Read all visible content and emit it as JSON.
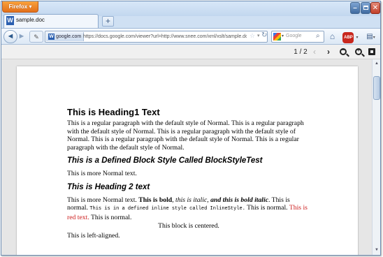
{
  "browser": {
    "menu_label": "Firefox",
    "menu_caret": "▾",
    "tab": {
      "icon_letter": "W",
      "title": "sample.doc"
    },
    "new_tab_symbol": "+",
    "nav": {
      "back_symbol": "◄",
      "forward_symbol": "►",
      "site_identity": "google.com",
      "url": "https://docs.google.com/viewer?url=http://www.snee.com/xml/xslt/sample.doc&emb",
      "bookmark_symbol": "☆",
      "reload_symbol": "↻",
      "search_placeholder": "Google",
      "search_symbol": "⌕",
      "home_symbol": "⌂",
      "adblock_label": "ABP",
      "dropdown_symbol": "▾",
      "menu_symbol": "▤"
    }
  },
  "viewer": {
    "page_indicator": "1 / 2",
    "prev_symbol": "‹",
    "next_symbol": "›",
    "zoom_out_symbol": "−",
    "zoom_in_symbol": "+"
  },
  "document": {
    "heading1": "This is Heading1 Text",
    "para1": "This is a regular paragraph with the default style of Normal. This is a regular paragraph with the default style of Normal. This is a regular paragraph with the default style of Normal. This is a regular paragraph with the default style of Normal. This is a regular paragraph with the default style of Normal.",
    "block_heading": "This is a Defined Block Style Called BlockStyleTest",
    "para2": "This is more Normal text.",
    "heading2": "This is Heading 2 text",
    "para3": {
      "t1": "This is more Normal text. ",
      "bold": "This is bold",
      "t2": ", ",
      "italic": "this is italic",
      "t3": ", ",
      "bolditalic": "and this is bold italic",
      "t4": ". This is normal. ",
      "inline_style": "This is in a defined inline style called InlineStyle.",
      "t5": " This is normal. ",
      "red": "This is red text.",
      "t6": " This is normal."
    },
    "centered": "This block is centered.",
    "left_aligned": "This is left-aligned."
  },
  "colors": {
    "firefox_orange": "#e3701a",
    "red_text": "#cc1b1b",
    "window_frame": "#cfe0f3"
  }
}
